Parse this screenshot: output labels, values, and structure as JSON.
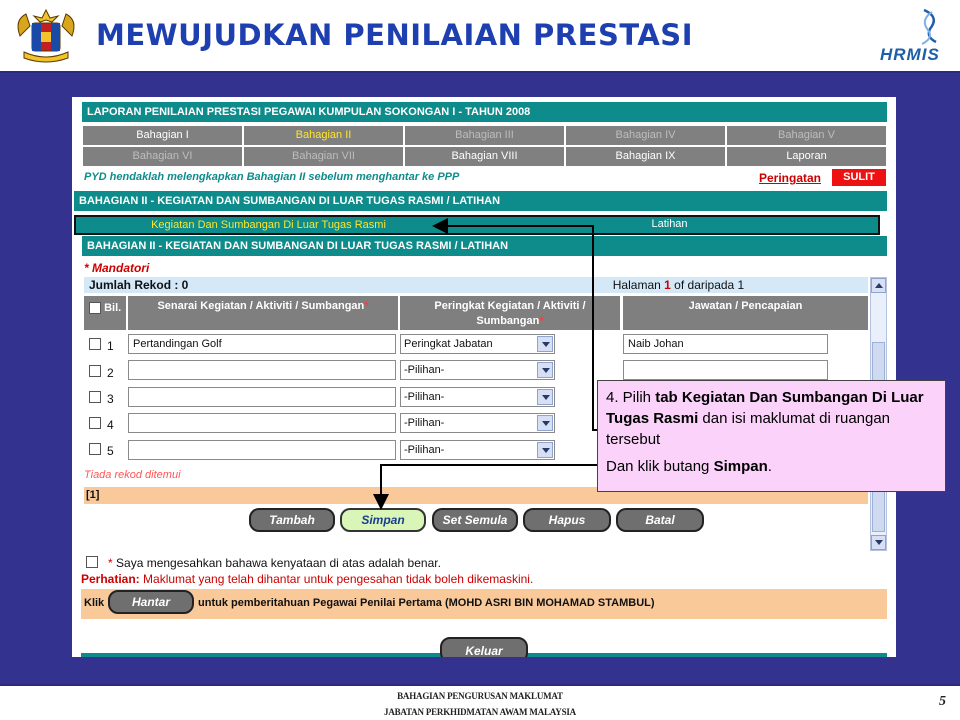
{
  "slide": {
    "title": "MEWUJUDKAN PENILAIAN PRESTASI",
    "logo_text": "HRMIS",
    "footer_line1": "BAHAGIAN PENGURUSAN MAKLUMAT",
    "footer_line2": "JABATAN PERKHIDMATAN AWAM MALAYSIA",
    "page_number": "5"
  },
  "form": {
    "report_title": "LAPORAN PENILAIAN PRESTASI PEGAWAI KUMPULAN SOKONGAN I - TAHUN 2008",
    "nav": [
      {
        "label": "Bahagian I",
        "state": "enabled"
      },
      {
        "label": "Bahagian II",
        "state": "active"
      },
      {
        "label": "Bahagian III",
        "state": "disabled"
      },
      {
        "label": "Bahagian IV",
        "state": "disabled"
      },
      {
        "label": "Bahagian V",
        "state": "disabled"
      },
      {
        "label": "Bahagian VI",
        "state": "disabled"
      },
      {
        "label": "Bahagian VII",
        "state": "disabled"
      },
      {
        "label": "Bahagian VIII",
        "state": "enabled"
      },
      {
        "label": "Bahagian IX",
        "state": "enabled"
      },
      {
        "label": "Laporan",
        "state": "enabled"
      }
    ],
    "pyd_note": "PYD hendaklah melengkapkan Bahagian II sebelum menghantar ke PPP",
    "warning_link": "Peringatan",
    "sulit": "SULIT",
    "section_title": "BAHAGIAN II - KEGIATAN DAN SUMBANGAN DI LUAR TUGAS RASMI / LATIHAN",
    "tabs": {
      "activities": "Kegiatan Dan Sumbangan Di Luar Tugas Rasmi",
      "training": "Latihan"
    },
    "subsection_title": "BAHAGIAN II - KEGIATAN DAN SUMBANGAN DI LUAR TUGAS RASMI / LATIHAN",
    "mandatory": "* Mandatori",
    "record_count": "Jumlah Rekod : 0",
    "pagination": {
      "prefix": "Halaman",
      "page": "1",
      "suffix": "of daripada 1"
    },
    "table": {
      "col_bil": "Bil.",
      "col_activity": "Senarai Kegiatan / Aktiviti / Sumbangan",
      "col_level": "Peringkat Kegiatan / Aktiviti / Sumbangan",
      "col_position": "Jawatan / Pencapaian",
      "rows": [
        {
          "num": "1",
          "activity": "Pertandingan Golf",
          "level": "Peringkat Jabatan",
          "position": "Naib Johan"
        },
        {
          "num": "2",
          "activity": "",
          "level": "-Pilihan-",
          "position": ""
        },
        {
          "num": "3",
          "activity": "",
          "level": "-Pilihan-",
          "position": ""
        },
        {
          "num": "4",
          "activity": "",
          "level": "-Pilihan-",
          "position": ""
        },
        {
          "num": "5",
          "activity": "",
          "level": "-Pilihan-",
          "position": ""
        }
      ]
    },
    "no_record": "Tiada rekod ditemui",
    "pager": "[1]",
    "buttons": {
      "add": "Tambah",
      "save": "Simpan",
      "reset": "Set Semula",
      "delete": "Hapus",
      "cancel": "Batal"
    },
    "confirm_text": "Saya mengesahkan bahawa kenyataan di atas adalah benar.",
    "notice_label": "Perhatian:",
    "notice_text": "Maklumat yang telah dihantar untuk pengesahan tidak boleh dikemaskini.",
    "submit_prefix": "Klik",
    "submit_button": "Hantar",
    "submit_suffix": "untuk pemberitahuan Pegawai Penilai Pertama (MOHD ASRI BIN MOHAMAD STAMBUL)",
    "exit_button": "Keluar"
  },
  "callout": {
    "step": "4. Pilih",
    "tab_phrase": "tab Kegiatan Dan Sumbangan Di Luar Tugas Rasmi",
    "fill_text": "dan isi maklumat di ruangan tersebut",
    "click_prefix": "Dan klik butang",
    "click_target": "Simpan",
    "click_suffix": "."
  },
  "colors": {
    "slide_bg": "#33338f",
    "teal": "#0e8c8c",
    "nav_grey": "#808080",
    "active_yellow": "#ffe42a",
    "callout_pink": "#fbd3fa",
    "peach": "#f9c99a"
  }
}
